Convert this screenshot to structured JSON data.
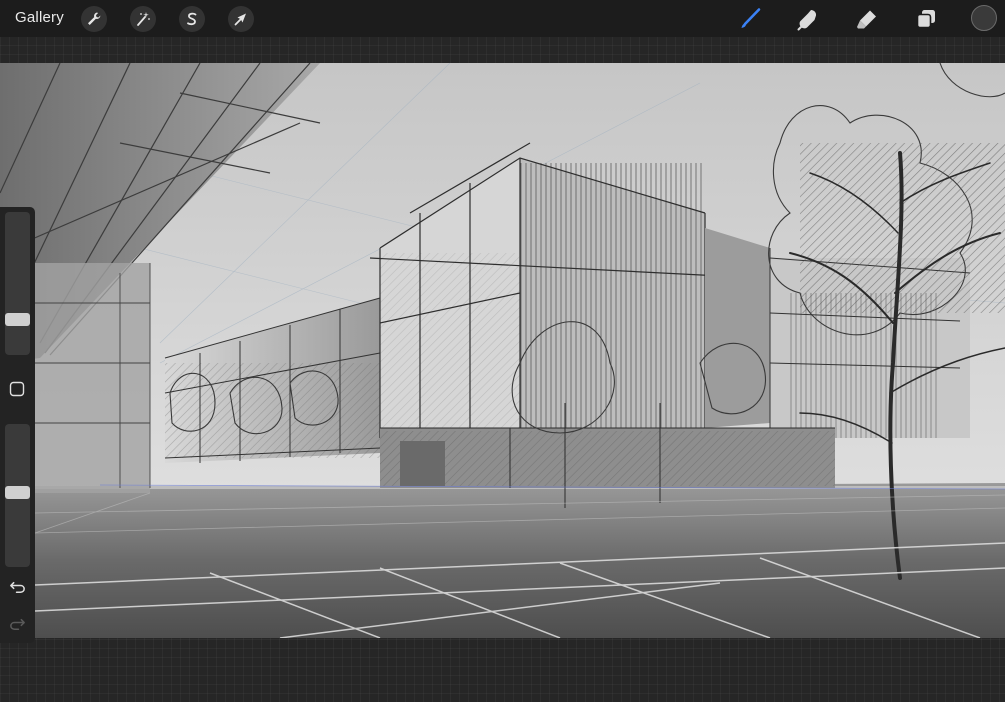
{
  "topbar": {
    "gallery_label": "Gallery",
    "left_tools": [
      {
        "name": "actions",
        "icon": "wrench-icon"
      },
      {
        "name": "adjustments",
        "icon": "magic-wand-icon"
      },
      {
        "name": "selection",
        "icon": "selection-s-icon"
      },
      {
        "name": "transform",
        "icon": "arrow-cursor-icon"
      }
    ],
    "right_tools": [
      {
        "name": "brush",
        "icon": "brush-icon",
        "active": true
      },
      {
        "name": "smudge",
        "icon": "smudge-finger-icon",
        "active": false
      },
      {
        "name": "eraser",
        "icon": "eraser-icon",
        "active": false
      },
      {
        "name": "layers",
        "icon": "layers-icon",
        "active": false
      }
    ],
    "color": "#3a3a3a"
  },
  "sidebar": {
    "brush_size_level": 0.22,
    "opacity_level": 0.52,
    "modify_icon": "square-modify-icon",
    "undo_icon": "undo-arrow-icon",
    "redo_icon": "redo-arrow-icon"
  },
  "colors": {
    "accent": "#3b82f6",
    "toolbar_bg": "#1c1c1c",
    "workspace_bg": "#262626",
    "canvas_sky": "#cfcfcf"
  }
}
